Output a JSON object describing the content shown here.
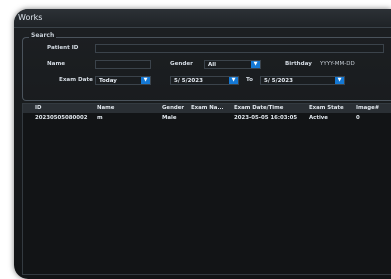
{
  "window": {
    "title": "Works"
  },
  "search": {
    "legend": "Search",
    "patient_id": {
      "label": "Patient ID",
      "value": ""
    },
    "name": {
      "label": "Name",
      "value": ""
    },
    "gender": {
      "label": "Gender",
      "value": "All"
    },
    "birthday": {
      "label": "Birthday",
      "placeholder": "YYYY-MM-DD"
    },
    "exam_date": {
      "label": "Exam Date",
      "value": "Today"
    },
    "date_from": "5/ 5/2023",
    "to_label": "To",
    "date_to": "5/ 5/2023"
  },
  "table": {
    "columns": [
      "ID",
      "Name",
      "Gender",
      "Exam Na...",
      "Exam Date/Time",
      "Exam State",
      "Image#"
    ],
    "rows": [
      [
        "20230505080002",
        "m",
        "Male",
        "",
        "2023-05-05 16:03:05",
        "Active",
        "0"
      ]
    ]
  },
  "colors": {
    "accent": "#1478d4",
    "background": "#15181b"
  },
  "icons": {
    "dropdown": "chevron-down-icon"
  }
}
